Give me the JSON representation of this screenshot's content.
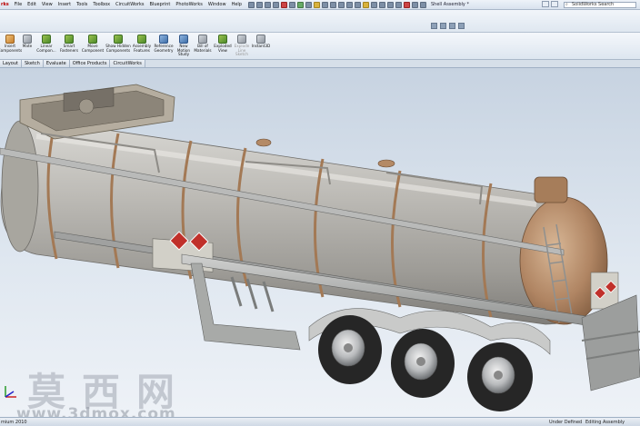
{
  "menubar": {
    "logo_fragment": "rks",
    "items": [
      "File",
      "Edit",
      "View",
      "Insert",
      "Tools",
      "Toolbox",
      "CircuitWorks",
      "Blueprint",
      "PhotoWorks",
      "Window",
      "Help"
    ],
    "document_title": "Shell Assembly *",
    "search_text": "SolidWorks Search"
  },
  "ribbon": {
    "commands": [
      {
        "label": "Insert Components",
        "icon": "insert-components-icon"
      },
      {
        "label": "Mate",
        "icon": "mate-icon"
      },
      {
        "label": "Linear Compon...",
        "icon": "linear-pattern-icon"
      },
      {
        "label": "Smart Fasteners",
        "icon": "smart-fasteners-icon"
      },
      {
        "label": "Move Component",
        "icon": "move-component-icon"
      },
      {
        "label": "Show Hidden Components",
        "icon": "show-hidden-icon"
      },
      {
        "label": "Assembly Features",
        "icon": "assembly-features-icon"
      },
      {
        "label": "Reference Geometry",
        "icon": "reference-geometry-icon"
      },
      {
        "label": "New Motion Study",
        "icon": "motion-study-icon"
      },
      {
        "label": "Bill of Materials",
        "icon": "bom-icon"
      },
      {
        "label": "Exploded View",
        "icon": "exploded-view-icon"
      },
      {
        "label": "Explode Line Sketch",
        "icon": "explode-line-icon",
        "disabled": true
      },
      {
        "label": "Instant3D",
        "icon": "instant3d-icon"
      }
    ]
  },
  "tabs": [
    "Layout",
    "Sketch",
    "Evaluate",
    "Office Products",
    "CircuitWorks"
  ],
  "active_tab": "Assembly",
  "watermark": {
    "chinese": "莫西网",
    "url": "www.3dmox.com"
  },
  "statusbar": {
    "left": "mium 2010",
    "middle": "Under Defined",
    "right": "Editing Assembly"
  },
  "colors": {
    "tank_body": "#b9b7b2",
    "tank_bands": "#b48a66",
    "frame": "#a8aaa8",
    "tire": "#2a2a2a",
    "hazard_placard": "#c0302a"
  }
}
